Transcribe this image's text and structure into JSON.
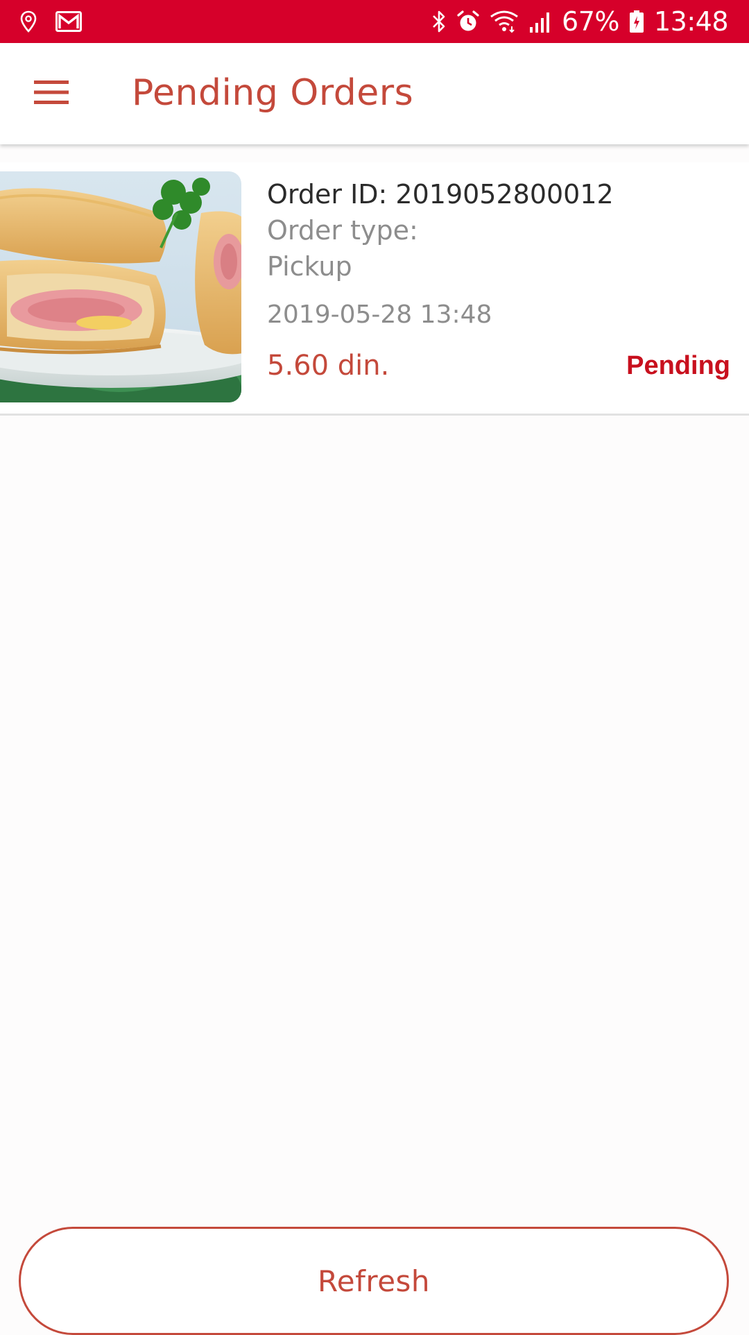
{
  "status_bar": {
    "battery_percent": "67%",
    "time": "13:48",
    "background_color": "#d6002a",
    "left_icons": [
      "location-pin-icon",
      "gmail-icon"
    ],
    "right_icons": [
      "bluetooth-icon",
      "alarm-icon",
      "wifi-icon",
      "signal-icon",
      "battery-icon"
    ]
  },
  "app_bar": {
    "title": "Pending Orders",
    "menu_icon": "hamburger-menu-icon",
    "accent_color": "#c4493b"
  },
  "orders": [
    {
      "order_id": "Order ID: 2019052800012",
      "order_type_label": "Order type:",
      "order_type_value": "Pickup",
      "date": "2019-05-28 13:48",
      "price": "5.60 din.",
      "status": "Pending",
      "status_color": "#c8101e"
    }
  ],
  "refresh_button": {
    "label": "Refresh"
  }
}
